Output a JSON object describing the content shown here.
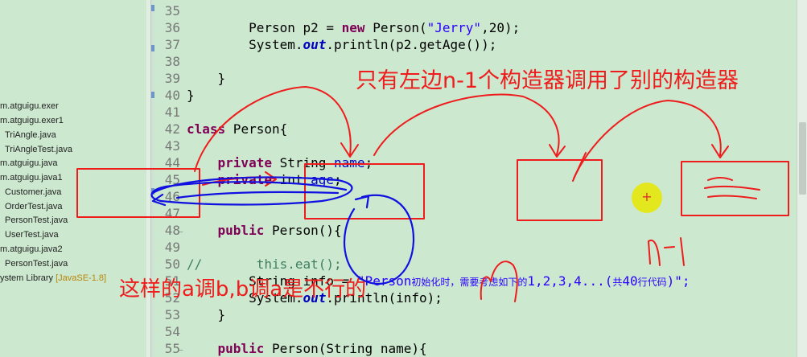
{
  "package_explorer": {
    "items": [
      "m.atguigu.exer",
      "m.atguigu.exer1",
      "TriAngle.java",
      "TriAngleTest.java",
      "m.atguigu.java",
      "m.atguigu.java1",
      "Customer.java",
      "OrderTest.java",
      "PersonTest.java",
      "UserTest.java",
      "m.atguigu.java2",
      "PersonTest.java"
    ],
    "system_library": "ystem Library",
    "jre": "[JavaSE-1.8]"
  },
  "editor": {
    "line_numbers": [
      "35",
      "36",
      "37",
      "38",
      "39",
      "40",
      "41",
      "42",
      "43",
      "44",
      "45",
      "46",
      "47",
      "48",
      "49",
      "50",
      "51",
      "52",
      "53",
      "54",
      "55"
    ],
    "code": {
      "l36_person": "Person p2 = ",
      "l36_new": "new",
      "l36_ctor": " Person(",
      "l36_str": "\"Jerry\"",
      "l36_end": ",20);",
      "l37_a": "System.",
      "l37_out": "out",
      "l37_b": ".println(p2.getAge());",
      "l39": "}",
      "l40": "}",
      "l42_class": "class",
      "l42_rest": " Person{",
      "l44_private": "private",
      "l44_type": " String ",
      "l44_field": "name",
      "l44_end": ";",
      "l45_private": "private",
      "l45_type": " int ",
      "l45_field": "age",
      "l45_end": ";",
      "l48_public": "public",
      "l48_rest": " Person(){",
      "l50_comment": "//       this.eat();",
      "l51_a": "String info = ",
      "l51_str": "\"Person",
      "l51_cn": "初始化时，需要考虑如下的",
      "l51_str2": "1,2,3,4...(",
      "l51_cn2": "共",
      "l51_str3": "40",
      "l51_cn3": "行代码",
      "l51_end": ")\";",
      "l52_a": "System.",
      "l52_out": "out",
      "l52_b": ".println(info);",
      "l53": "}",
      "l55_public": "public",
      "l55_rest": " Person(String name){"
    }
  },
  "annotations": {
    "top_note": "只有左边n-1个构造器调用了别的构造器",
    "bottom_note": "这样的a调b,b调a是不行的",
    "n_label": "n",
    "n_minus_1": "n-1",
    "equals_mark": "=",
    "cursor_plus": "+"
  },
  "colors": {
    "background": "#cce8cf",
    "annotation_red": "#ee1c1c",
    "annotation_blue": "#1010e0",
    "keyword": "#7f0055",
    "string": "#2a00ff"
  }
}
